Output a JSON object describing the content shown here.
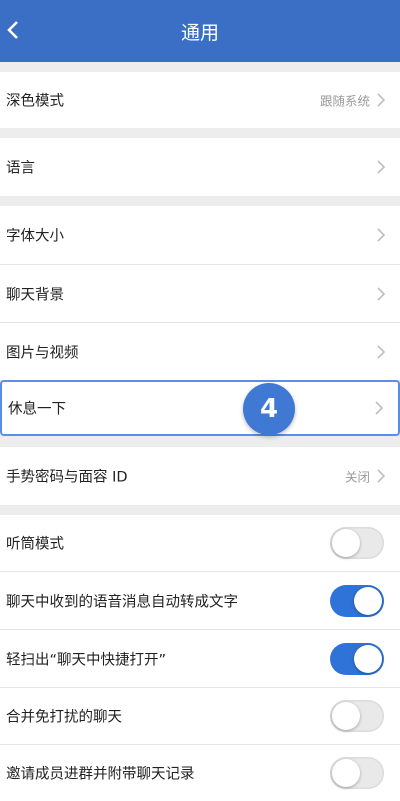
{
  "header": {
    "title": "通用"
  },
  "rows": {
    "dark_mode": {
      "label": "深色模式",
      "value": "跟随系统"
    },
    "language": {
      "label": "语言"
    },
    "font_size": {
      "label": "字体大小"
    },
    "chat_background": {
      "label": "聊天背景"
    },
    "photos_videos": {
      "label": "图片与视频"
    },
    "take_break": {
      "label": "休息一下"
    },
    "gesture_faceid": {
      "label": "手势密码与面容 ID",
      "value": "关闭"
    },
    "earpiece_mode": {
      "label": "听筒模式",
      "on": false
    },
    "voice_to_text": {
      "label": "聊天中收到的语音消息自动转成文字",
      "on": true
    },
    "swipe_quick_open": {
      "label": "轻扫出“聊天中快捷打开”",
      "on": true
    },
    "merge_muted": {
      "label": "合并免打扰的聊天",
      "on": false
    },
    "invite_history": {
      "label": "邀请成员进群并附带聊天记录",
      "on": false
    }
  },
  "badge": {
    "step": "4"
  },
  "colors": {
    "header": "#3a6fc5",
    "toggle_on": "#2f73d8",
    "highlight": "#5b8ee8"
  }
}
